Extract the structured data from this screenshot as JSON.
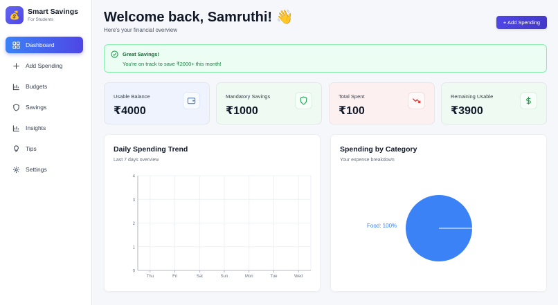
{
  "brand": {
    "title": "Smart Savings",
    "subtitle": "For Students",
    "logo_icon": "money-bag-icon"
  },
  "nav": [
    {
      "label": "Dashboard",
      "icon": "dashboard-icon",
      "active": true
    },
    {
      "label": "Add Spending",
      "icon": "plus-icon",
      "active": false
    },
    {
      "label": "Budgets",
      "icon": "bar-chart-icon",
      "active": false
    },
    {
      "label": "Savings",
      "icon": "shield-icon",
      "active": false
    },
    {
      "label": "Insights",
      "icon": "bar-chart-icon",
      "active": false
    },
    {
      "label": "Tips",
      "icon": "lightbulb-icon",
      "active": false
    },
    {
      "label": "Settings",
      "icon": "gear-icon",
      "active": false
    }
  ],
  "header": {
    "title": "Welcome back, Samruthi! 👋",
    "subtitle": "Here's your financial overview",
    "add_button": "+ Add Spending"
  },
  "alert": {
    "title": "Great Savings!",
    "message": "You're on track to save ₹2000+ this month!",
    "icon": "check-circle-icon"
  },
  "cards": [
    {
      "label": "Usable Balance",
      "value": "₹4000",
      "icon": "wallet-icon",
      "bg": "#eef3fd",
      "accent": "#3b82f6"
    },
    {
      "label": "Mandatory Savings",
      "value": "₹1000",
      "icon": "shield-icon",
      "bg": "#eefaf2",
      "accent": "#16a34a"
    },
    {
      "label": "Total Spent",
      "value": "₹100",
      "icon": "trending-down-icon",
      "bg": "#fdf0f0",
      "accent": "#dc2626"
    },
    {
      "label": "Remaining Usable",
      "value": "₹3900",
      "icon": "dollar-icon",
      "bg": "#eefaf2",
      "accent": "#16a34a"
    }
  ],
  "trend_panel": {
    "title": "Daily Spending Trend",
    "subtitle": "Last 7 days overview"
  },
  "category_panel": {
    "title": "Spending by Category",
    "subtitle": "Your expense breakdown"
  },
  "chart_data": [
    {
      "type": "line",
      "categories": [
        "Thu",
        "Fri",
        "Sat",
        "Sun",
        "Mon",
        "Tue",
        "Wed"
      ],
      "series": [],
      "ylim": [
        0,
        4
      ],
      "yticks": [
        0,
        1,
        2,
        3,
        4
      ],
      "grid": true
    },
    {
      "type": "pie",
      "labels": [
        "Food"
      ],
      "values": [
        100
      ],
      "data_labels": [
        "Food: 100%"
      ],
      "colors": [
        "#3b82f6"
      ]
    }
  ]
}
